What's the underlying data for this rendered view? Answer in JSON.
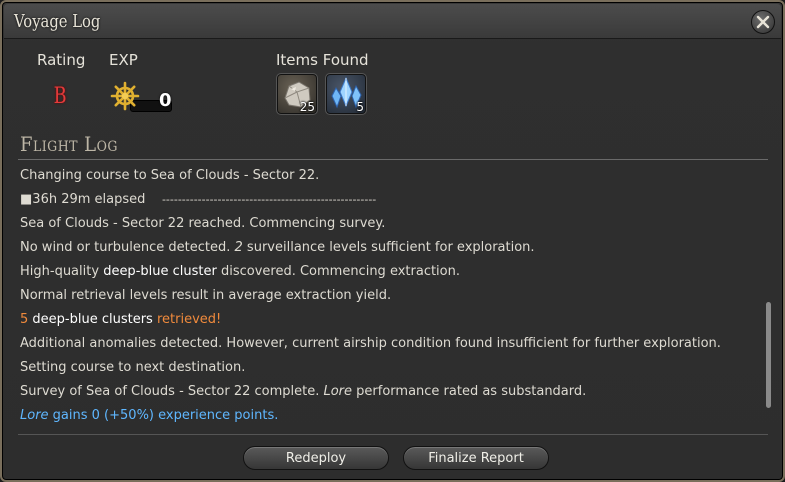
{
  "window": {
    "title": "Voyage Log"
  },
  "stats": {
    "rating_label": "Rating",
    "rating_value": "B",
    "exp_label": "EXP",
    "exp_value": "0",
    "items_label": "Items Found",
    "items": [
      {
        "icon": "ore-icon",
        "count": "25"
      },
      {
        "icon": "crystal-icon",
        "count": "5"
      }
    ]
  },
  "flight_log": {
    "header": "Flight Log",
    "entries": {
      "e1": "Changing course to Sea of Clouds - Sector 22.",
      "e2_marker": "■",
      "e2_text": "36h 29m elapsed",
      "e2_dashes": "------------------------------------------------------",
      "e3": "Sea of Clouds - Sector 22 reached. Commencing survey.",
      "e4_pre": "No wind or turbulence detected. ",
      "e4_num": "2",
      "e4_post": " surveillance levels sufficient for exploration.",
      "e5_pre": "High-quality ",
      "e5_item": "deep-blue cluster",
      "e5_post": " discovered. Commencing extraction.",
      "e6": "Normal retrieval levels result in average extraction yield.",
      "e7_num": "5",
      "e7_item": " deep-blue clusters ",
      "e7_post": "retrieved!",
      "e8": "Additional anomalies detected. However, current airship condition found insufficient for further exploration. Setting course to next destination.",
      "e9_pre": "Survey of Sea of Clouds - Sector 22 complete. ",
      "e9_name": "Lore",
      "e9_post": " performance rated as substandard.",
      "e10_name": "Lore",
      "e10_post": " gains 0 (+50%) experience points."
    }
  },
  "buttons": {
    "redeploy": "Redeploy",
    "finalize": "Finalize Report"
  },
  "colors": {
    "rating": "#e63a3a",
    "highlight_orange": "#f08a3c",
    "highlight_blue": "#5fb7ff"
  }
}
